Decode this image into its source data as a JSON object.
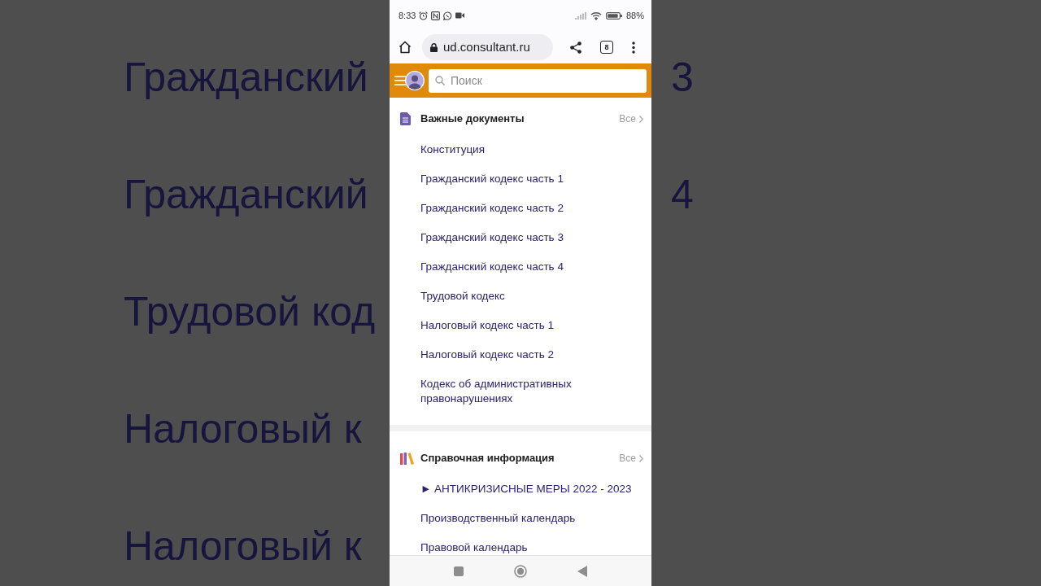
{
  "background": {
    "left_texts": [
      "Гражданский",
      "Гражданский",
      "Трудовой код",
      "Налоговый к",
      "Налоговый к"
    ],
    "right_texts": [
      "3",
      "4"
    ]
  },
  "status_bar": {
    "time": "8:33",
    "battery": "88%"
  },
  "browser_bar": {
    "url": "ud.consultant.ru",
    "tab_count": "8"
  },
  "site_header": {
    "search": {
      "placeholder": "Поиск"
    }
  },
  "sections": [
    {
      "kind": "documents",
      "title": "Важные документы",
      "all_link": "Все",
      "items": [
        "Конституция",
        "Гражданский кодекс часть 1",
        "Гражданский кодекс часть 2",
        "Гражданский кодекс часть 3",
        "Гражданский кодекс часть 4",
        "Трудовой кодекс",
        "Налоговый кодекс часть 1",
        "Налоговый кодекс часть 2",
        "Кодекс об административных правонарушениях"
      ]
    },
    {
      "kind": "reference",
      "title": "Справочная информация",
      "all_link": "Все",
      "items": [
        "► АНТИКРИЗИСНЫЕ МЕРЫ 2022 - 2023",
        "Производственный календарь",
        "Правовой календарь"
      ]
    }
  ]
}
